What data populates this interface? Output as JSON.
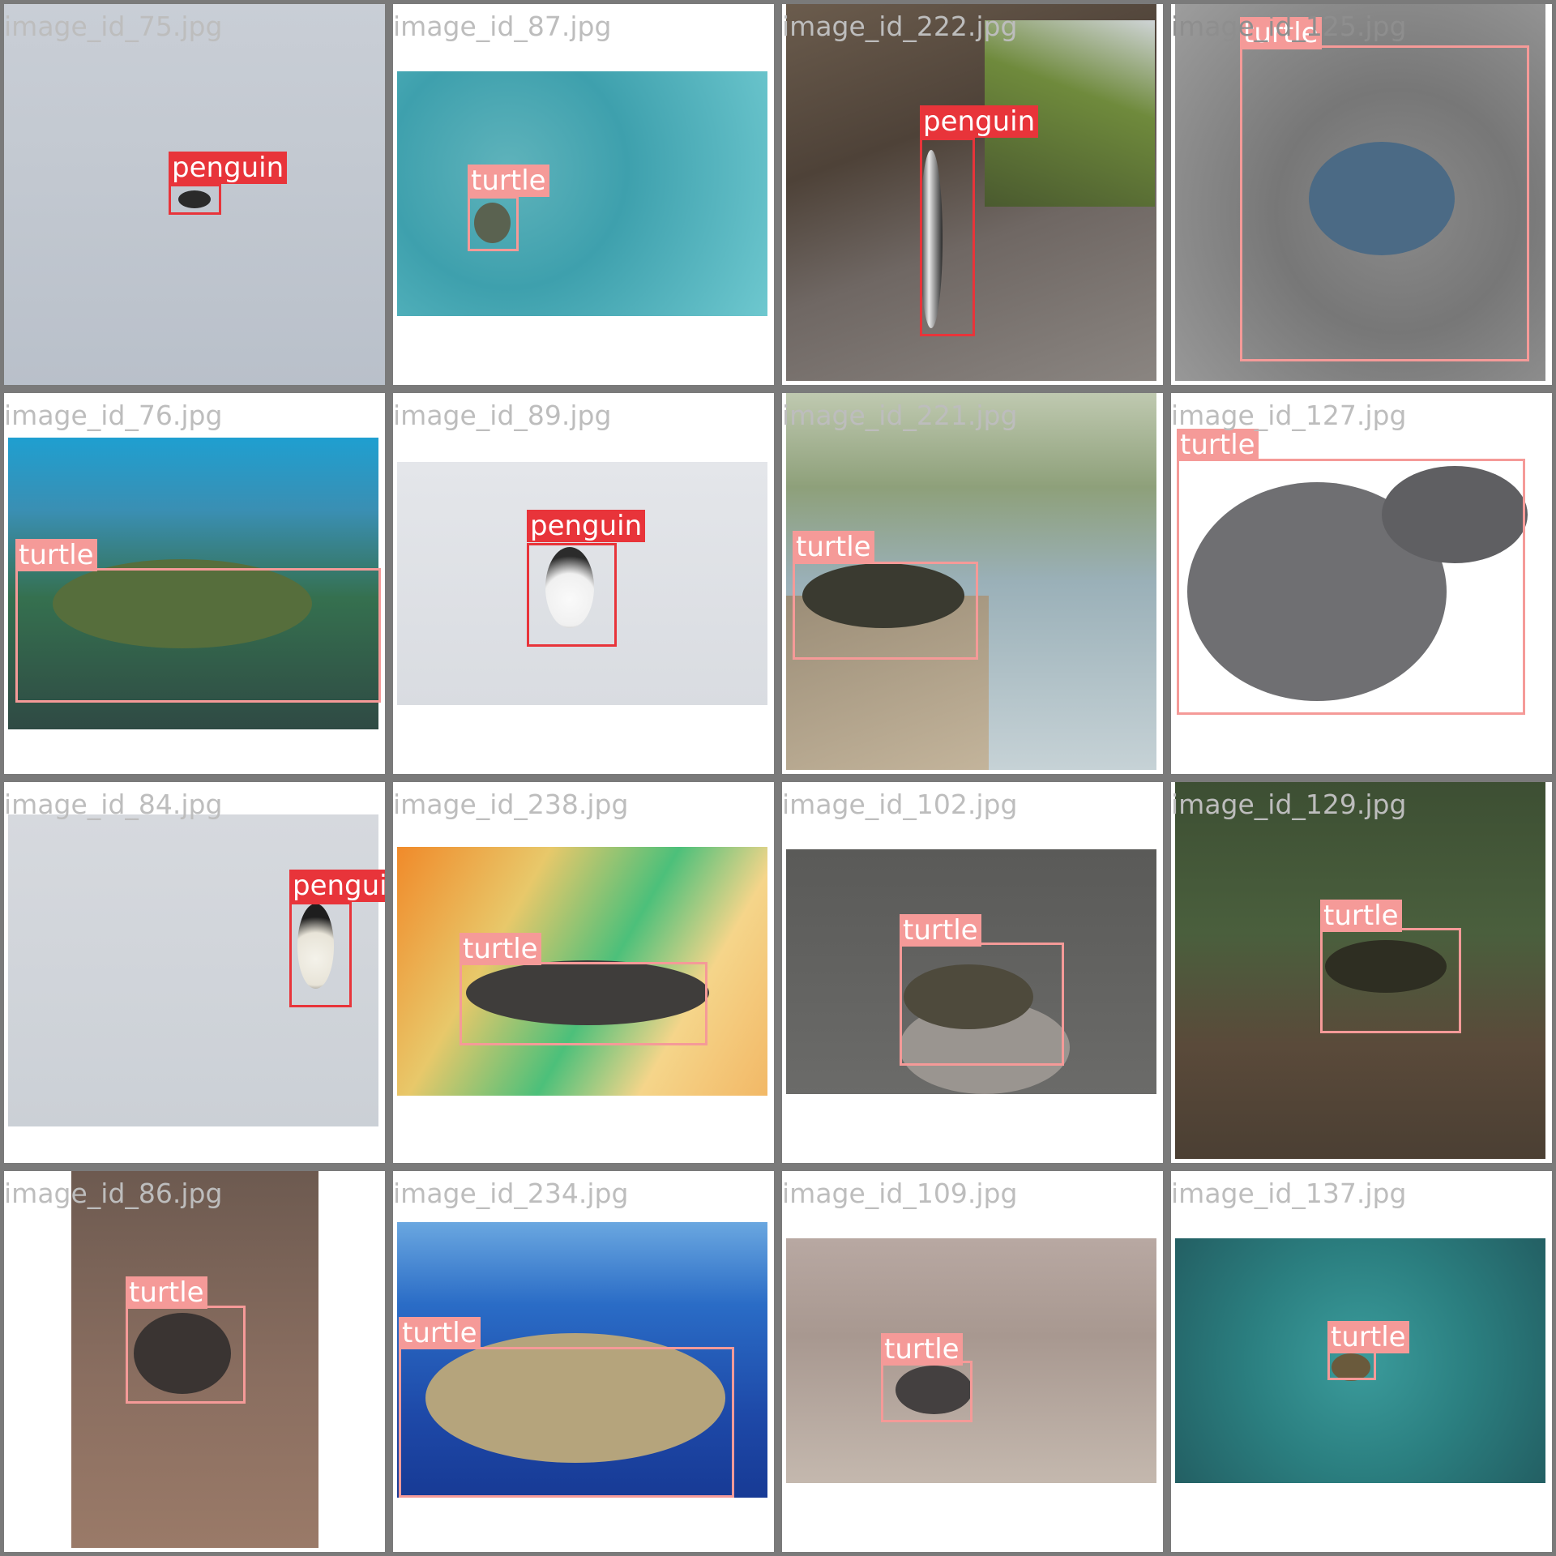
{
  "classes": {
    "penguin": "#e8343a",
    "turtle": "#f59a98"
  },
  "tiles": [
    {
      "filename": "image_id_75.jpg",
      "label": "penguin"
    },
    {
      "filename": "image_id_87.jpg",
      "label": "turtle"
    },
    {
      "filename": "image_id_222.jpg",
      "label": "penguin"
    },
    {
      "filename": "image_id_125.jpg",
      "label": "turtle"
    },
    {
      "filename": "image_id_76.jpg",
      "label": "turtle"
    },
    {
      "filename": "image_id_89.jpg",
      "label": "penguin"
    },
    {
      "filename": "image_id_221.jpg",
      "label": "turtle"
    },
    {
      "filename": "image_id_127.jpg",
      "label": "turtle"
    },
    {
      "filename": "image_id_84.jpg",
      "label": "penguin"
    },
    {
      "filename": "image_id_238.jpg",
      "label": "turtle"
    },
    {
      "filename": "image_id_102.jpg",
      "label": "turtle"
    },
    {
      "filename": "image_id_129.jpg",
      "label": "turtle"
    },
    {
      "filename": "image_id_86.jpg",
      "label": "turtle"
    },
    {
      "filename": "image_id_234.jpg",
      "label": "turtle"
    },
    {
      "filename": "image_id_109.jpg",
      "label": "turtle"
    },
    {
      "filename": "image_id_137.jpg",
      "label": "turtle"
    }
  ]
}
